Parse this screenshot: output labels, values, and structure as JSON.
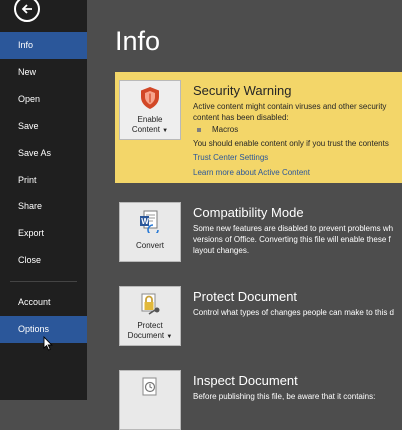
{
  "sidebar": {
    "items": [
      {
        "label": "Info"
      },
      {
        "label": "New"
      },
      {
        "label": "Open"
      },
      {
        "label": "Save"
      },
      {
        "label": "Save As"
      },
      {
        "label": "Print"
      },
      {
        "label": "Share"
      },
      {
        "label": "Export"
      },
      {
        "label": "Close"
      },
      {
        "label": "Account"
      },
      {
        "label": "Options"
      }
    ],
    "active_index": 0,
    "hover_index": 10
  },
  "main": {
    "title": "Info",
    "security": {
      "title": "Security Warning",
      "line1": "Active content might contain viruses and other security",
      "line2": "content has been disabled:",
      "bullet": "Macros",
      "line3": "You should enable content only if you trust the contents",
      "link1": "Trust Center Settings",
      "link2": "Learn more about Active Content",
      "button_line1": "Enable",
      "button_line2": "Content"
    },
    "compatibility": {
      "title": "Compatibility Mode",
      "line1": "Some new features are disabled to prevent problems wh",
      "line2": "versions of Office. Converting this file will enable these f",
      "line3": "layout changes.",
      "button": "Convert"
    },
    "protect": {
      "title": "Protect Document",
      "line1": "Control what types of changes people can make to this d",
      "button_line1": "Protect",
      "button_line2": "Document"
    },
    "inspect": {
      "title": "Inspect Document",
      "line1": "Before publishing this file, be aware that it contains:"
    }
  },
  "colors": {
    "sidebar_bg": "#1f1f1f",
    "active_bg": "#2b579a",
    "content_bg": "#4d4d4d",
    "warning_bg": "#f3d669"
  }
}
